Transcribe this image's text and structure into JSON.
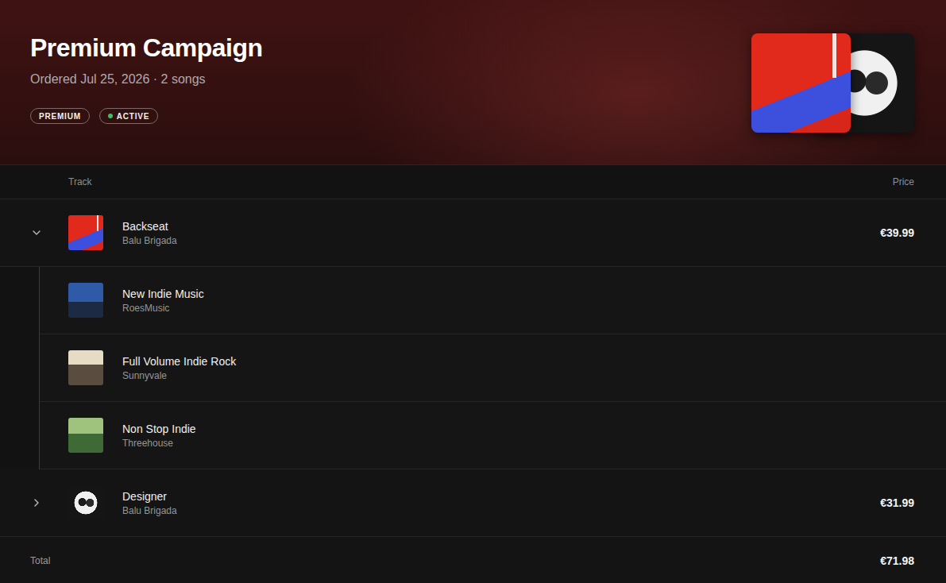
{
  "campaign": {
    "title": "Premium Campaign",
    "subtitle": "Ordered Jul 25, 2026 · 2 songs",
    "badges": [
      {
        "label": "PREMIUM",
        "kind": "plain"
      },
      {
        "label": "ACTIVE",
        "kind": "status",
        "color": "#3fbf5f"
      }
    ]
  },
  "table": {
    "columns": [
      "Track",
      "Price"
    ],
    "rows": [
      {
        "title": "Backseat",
        "artist": "Balu Brigada",
        "price": "€39.99",
        "expanded": true,
        "playlists": [
          {
            "name": "New Indie Music",
            "curator": "RoesMusic"
          },
          {
            "name": "Full Volume Indie Rock",
            "curator": "Sunnyvale"
          },
          {
            "name": "Non Stop Indie",
            "curator": "Threehouse"
          }
        ]
      },
      {
        "title": "Designer",
        "artist": "Balu Brigada",
        "price": "€31.99",
        "expanded": false,
        "playlists": []
      }
    ]
  },
  "total": {
    "label": "Total",
    "value": "€71.98"
  }
}
